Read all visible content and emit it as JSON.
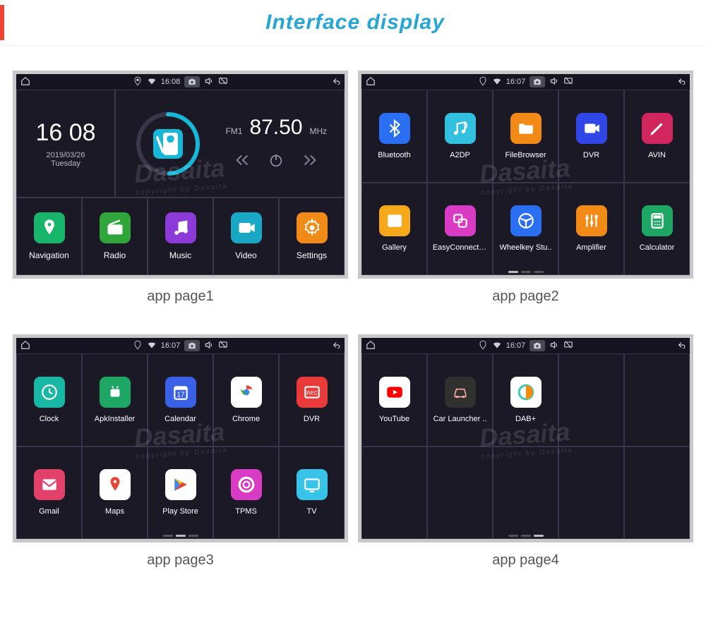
{
  "header": {
    "title": "Interface display"
  },
  "captions": [
    "app page1",
    "app page2",
    "app page3",
    "app page4"
  ],
  "watermark": {
    "brand": "Dasaita",
    "sub": "copyright by Dasaita"
  },
  "statusbar": {
    "time1": "16:08",
    "time_other": "16:07"
  },
  "panel1": {
    "clock": {
      "time": "16 08",
      "date": "2019/03/26",
      "day": "Tuesday"
    },
    "radio": {
      "band": "FM1",
      "freq": "87.50",
      "unit": "MHz"
    },
    "tiles": [
      {
        "label": "Navigation",
        "color": "#16b56a",
        "icon": "pin"
      },
      {
        "label": "Radio",
        "color": "#2fa53a",
        "icon": "radio"
      },
      {
        "label": "Music",
        "color": "#8c3bd8",
        "icon": "music"
      },
      {
        "label": "Video",
        "color": "#19a7c6",
        "icon": "video"
      },
      {
        "label": "Settings",
        "color": "#f28a18",
        "icon": "gear"
      }
    ]
  },
  "panel2": {
    "active": 0,
    "apps": [
      {
        "label": "Bluetooth",
        "color": "#2a6ff2",
        "icon": "bt"
      },
      {
        "label": "A2DP",
        "color": "#31c0e0",
        "icon": "a2dp"
      },
      {
        "label": "FileBrowser",
        "color": "#f28a18",
        "icon": "folder"
      },
      {
        "label": "DVR",
        "color": "#3046e6",
        "icon": "dvr"
      },
      {
        "label": "AVIN",
        "color": "#d0265d",
        "icon": "pen"
      },
      {
        "label": "Gallery",
        "color": "#f4a81a",
        "icon": "image"
      },
      {
        "label": "EasyConnection",
        "color": "#d93bc5",
        "icon": "link"
      },
      {
        "label": "Wheelkey Stu..",
        "color": "#2a6ff2",
        "icon": "wheel"
      },
      {
        "label": "Amplifier",
        "color": "#f28a18",
        "icon": "sliders"
      },
      {
        "label": "Calculator",
        "color": "#1ea664",
        "icon": "calc"
      }
    ]
  },
  "panel3": {
    "active": 1,
    "apps": [
      {
        "label": "Clock",
        "color": "#19b7a5",
        "icon": "clock"
      },
      {
        "label": "ApkInstaller",
        "color": "#1ea664",
        "icon": "android"
      },
      {
        "label": "Calendar",
        "color": "#3b62e6",
        "icon": "cal"
      },
      {
        "label": "Chrome",
        "color": "#ffffff",
        "icon": "chrome"
      },
      {
        "label": "DVR",
        "color": "#e93a3a",
        "icon": "rec"
      },
      {
        "label": "Gmail",
        "color": "#e2426a",
        "icon": "mail"
      },
      {
        "label": "Maps",
        "color": "#ffffff",
        "icon": "gmap"
      },
      {
        "label": "Play Store",
        "color": "#ffffff",
        "icon": "play"
      },
      {
        "label": "TPMS",
        "color": "#d93bc5",
        "icon": "tire"
      },
      {
        "label": "TV",
        "color": "#37c4e8",
        "icon": "tv"
      }
    ]
  },
  "panel4": {
    "active": 2,
    "apps": [
      {
        "label": "YouTube",
        "color": "#ffffff",
        "icon": "yt"
      },
      {
        "label": "Car Launcher ..",
        "color": "#30302f",
        "icon": "car"
      },
      {
        "label": "DAB+",
        "color": "#ffffff",
        "icon": "dab"
      }
    ]
  }
}
